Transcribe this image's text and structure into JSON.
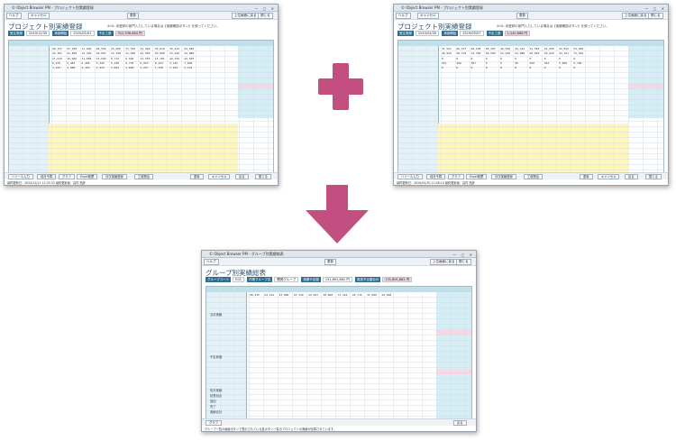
{
  "window_title": "© Object Browser PM - プロジェクト別実績登録",
  "top_left": {
    "toolbar": {
      "help": "ヘルプ",
      "cancel": "キャンセル",
      "update": "更新",
      "top_menu": "上位画面に戻る",
      "close": "閉じる"
    },
    "page_title": "プロジェクト別実績登録",
    "note": "※10: 未登録の部門入力している場合は【実績確認ボタン】を使ってください。",
    "header": [
      {
        "label": "受注登録"
      },
      {
        "value": "2019/12/30"
      },
      {
        "label": "実施開始"
      },
      {
        "value": "2020/01/01"
      },
      {
        "label": "予定工数"
      },
      {
        "value": "312,336,664 円"
      }
    ],
    "footer_buttons": [
      "リソース入力",
      "前月予算",
      "グラフ",
      "Excel帳票",
      "月次実績登録",
      "工程照会",
      "更新",
      "キャンセル",
      "戻る",
      "閉じる"
    ],
    "status": "最終更新日：2020/12/11 12:35:33 最終更新者：高村 拓彦"
  },
  "top_right": {
    "toolbar": {
      "help": "ヘルプ",
      "cancel": "キャンセル",
      "update": "更新",
      "top_menu": "上位画面に戻る",
      "close": "閉じる"
    },
    "page_title": "プロジェクト別実績登録",
    "note": "※10: 未登録の部門入力している場合は【実績確認ボタン】を使ってください。",
    "header": [
      {
        "label": "受注登録"
      },
      {
        "value": "2019/04/30"
      },
      {
        "label": "実施開始"
      },
      {
        "value": "2019/05/07"
      },
      {
        "label": "予定工数"
      },
      {
        "value": "1,240,668 円"
      }
    ],
    "footer_buttons": [
      "リソース入力",
      "前月予算",
      "グラフ",
      "Excel帳票",
      "月次実績登録",
      "工程照会",
      "更新",
      "キャンセル",
      "戻る",
      "閉じる"
    ],
    "status": "最終更新日：2020/04/30 12:08:14 最終更新者：高村 拓彦"
  },
  "bottom": {
    "window_title": "© Object Browser PM - グループ別実績総表",
    "toolbar": {
      "help": "ヘルプ",
      "update": "更新",
      "top_menu": "上位画面に戻る",
      "close": "閉じる"
    },
    "page_title": "グループ別実績総表",
    "header": [
      {
        "label": "グループコード"
      },
      {
        "value": "E01"
      },
      {
        "label": "作業グループ名"
      },
      {
        "value": "開発グループ"
      },
      {
        "label": "実績予定額"
      },
      {
        "value": "131,891,882 円"
      },
      {
        "label": "実施予定額合計"
      },
      {
        "value": "131,891,882 円"
      }
    ],
    "row_labels": [
      "当月実績",
      "予定原価",
      "前月実績",
      "延長割合",
      "追加",
      "完了",
      "実績合計"
    ],
    "footer_buttons": [
      "グラフ",
      "戻る"
    ],
    "status": "グループ一覧の画面ボタンで表示されている各ボタン一覧のプロジェクトの実績が合算されています。",
    "sample_values": [
      "28,435",
      "24,124",
      "23,886",
      "25,130",
      "24,953",
      "30,600",
      "31,416",
      "29,715",
      "31,000",
      "44,060"
    ]
  }
}
